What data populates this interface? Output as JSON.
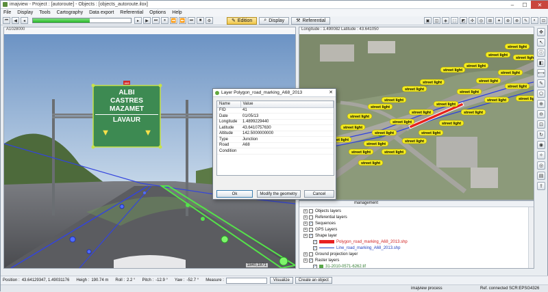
{
  "window": {
    "title": "imajview - Project : [autoroute] - Objects : [objects_autoroute.ilox]"
  },
  "menu": [
    "File",
    "Display",
    "Tools",
    "Cartography",
    "Data export",
    "Referential",
    "Options",
    "Help"
  ],
  "toolbar": {
    "progress": 0.58,
    "modes": [
      {
        "label": "Edition",
        "active": true,
        "icon": "pencil-icon"
      },
      {
        "label": "Display",
        "active": false,
        "icon": "magnifier-icon"
      },
      {
        "label": "Referential",
        "active": false,
        "icon": "tools-icon"
      }
    ]
  },
  "left_pane": {
    "image_id": "A1028000",
    "pixel_coords": "1840,1871",
    "sign_lines": [
      "ALBI",
      "CASTRES",
      "MAZAMET",
      "LAVAUR"
    ],
    "road_label": "A68"
  },
  "right_pane": {
    "coords_label": "Longitude : 1.490082 Latitude : 43.641050",
    "map_label": "street light"
  },
  "dialog": {
    "title": "Layer Polygon_road_marking_A68_2013",
    "columns": [
      "Name",
      "Value"
    ],
    "rows": [
      {
        "name": "FID",
        "value": "41"
      },
      {
        "name": "Date",
        "value": "01/05/13"
      },
      {
        "name": "Longitude",
        "value": "1.4899229440"
      },
      {
        "name": "Latitude",
        "value": "43.6410757630"
      },
      {
        "name": "Altitude",
        "value": "142.5000000000"
      },
      {
        "name": "Type",
        "value": "Junction"
      },
      {
        "name": "Road",
        "value": "A68"
      },
      {
        "name": "Condition",
        "value": ""
      }
    ],
    "buttons": {
      "ok": "Ok",
      "modify": "Modify the geometry",
      "cancel": "Cancel"
    }
  },
  "layers": {
    "header": "management",
    "items": [
      {
        "label": "Objects layers",
        "level": 0,
        "checked": false,
        "style": ""
      },
      {
        "label": "Referential layers",
        "level": 0,
        "checked": false,
        "style": ""
      },
      {
        "label": "Sequences",
        "level": 0,
        "checked": true,
        "style": ""
      },
      {
        "label": "GPS Layers",
        "level": 0,
        "checked": false,
        "style": ""
      },
      {
        "label": "Shape layer",
        "level": 0,
        "checked": true,
        "style": ""
      },
      {
        "label": "Polygon_road_marking_A68_2013.shp",
        "level": 1,
        "checked": true,
        "style": "red"
      },
      {
        "label": "Line_road_marking_A68_2013.shp",
        "level": 1,
        "checked": true,
        "style": "blue"
      },
      {
        "label": "Ground projection layer",
        "level": 0,
        "checked": false,
        "style": ""
      },
      {
        "label": "Raster layers",
        "level": 0,
        "checked": true,
        "style": ""
      },
      {
        "label": "31-2010-0571-6262.tif",
        "level": 1,
        "checked": true,
        "style": "green"
      },
      {
        "label": "31-2010-0571-6263.tif",
        "level": 1,
        "checked": true,
        "style": "green"
      }
    ]
  },
  "status": {
    "position_label": "Position :",
    "position": "43.64129347, 1.49031176",
    "height_label": "Heigh :",
    "height": "190.74 m",
    "roll_label": "Roll :",
    "roll": "2.2 °",
    "pitch_label": "Pitch :",
    "pitch": "-12.9 °",
    "yaw_label": "Yaw :",
    "yaw": "-52.7 °",
    "measure_label": "Measure :",
    "visualize": "Visualize",
    "create": "Create an object",
    "process": "imajview process",
    "ref": "Ref. connected",
    "scr": "SCR:EPSG4326"
  }
}
